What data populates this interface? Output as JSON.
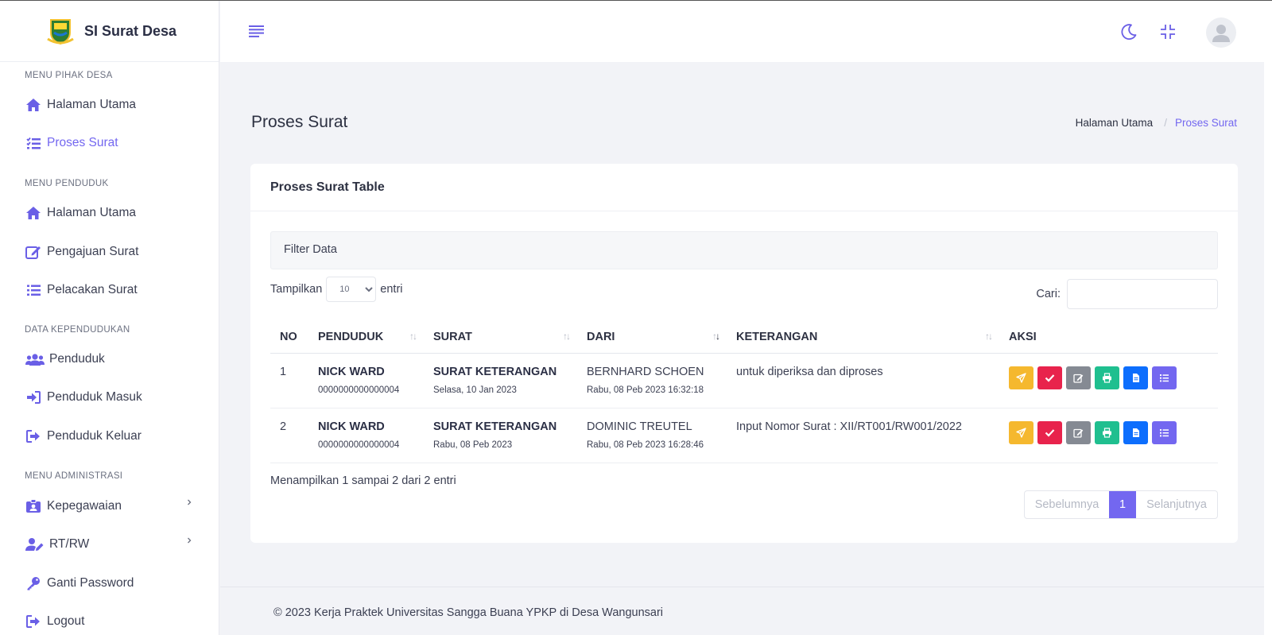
{
  "app": {
    "title": "SI Surat Desa"
  },
  "sidebar": {
    "sections": [
      {
        "label": "MENU PIHAK DESA",
        "items": [
          {
            "label": "Halaman Utama",
            "icon": "home-icon"
          },
          {
            "label": "Proses Surat",
            "icon": "list-check-icon",
            "active": true
          }
        ]
      },
      {
        "label": "MENU PENDUDUK",
        "items": [
          {
            "label": "Halaman Utama",
            "icon": "home-icon"
          },
          {
            "label": "Pengajuan Surat",
            "icon": "edit-icon"
          },
          {
            "label": "Pelacakan Surat",
            "icon": "list-icon"
          }
        ]
      },
      {
        "label": "DATA KEPENDUDUKAN",
        "items": [
          {
            "label": "Penduduk",
            "icon": "users-icon"
          },
          {
            "label": "Penduduk Masuk",
            "icon": "sign-in-icon"
          },
          {
            "label": "Penduduk Keluar",
            "icon": "sign-out-icon"
          }
        ]
      },
      {
        "label": "MENU ADMINISTRASI",
        "items": [
          {
            "label": "Kepegawaian",
            "icon": "id-badge-icon",
            "submenu": true
          },
          {
            "label": "RT/RW",
            "icon": "user-edit-icon",
            "submenu": true
          },
          {
            "label": "Ganti Password",
            "icon": "key-icon"
          },
          {
            "label": "Logout",
            "icon": "logout-icon"
          }
        ]
      }
    ]
  },
  "header": {
    "page_title": "Proses Surat",
    "breadcrumb": [
      "Halaman Utama",
      "Proses Surat"
    ]
  },
  "card": {
    "title": "Proses Surat Table",
    "filter_label": "Filter Data",
    "length_prefix": "Tampilkan",
    "length_value": "10",
    "length_suffix": "entri",
    "search_label": "Cari:",
    "columns": [
      "NO",
      "PENDUDUK",
      "SURAT",
      "DARI",
      "KETERANGAN",
      "AKSI"
    ],
    "rows": [
      {
        "no": "1",
        "penduduk": "NICK WARD",
        "nik": "0000000000000004",
        "surat": "SURAT KETERANGAN",
        "surat_date": "Selasa, 10 Jan 2023",
        "dari": "BERNHARD SCHOEN",
        "dari_date": "Rabu, 08 Peb 2023 16:32:18",
        "keterangan": "untuk diperiksa dan diproses"
      },
      {
        "no": "2",
        "penduduk": "NICK WARD",
        "nik": "0000000000000004",
        "surat": "SURAT KETERANGAN",
        "surat_date": "Rabu, 08 Peb 2023",
        "dari": "DOMINIC TREUTEL",
        "dari_date": "Rabu, 08 Peb 2023 16:28:46",
        "keterangan": "Input Nomor Surat : XII/RT001/RW001/2022"
      }
    ],
    "info": "Menampilkan 1 sampai 2 dari 2 entri",
    "pager": {
      "prev": "Sebelumnya",
      "current": "1",
      "next": "Selanjutnya"
    }
  },
  "footer": {
    "text": "© 2023 Kerja Praktek Universitas Sangga Buana YPKP di Desa Wangunsari"
  },
  "colors": {
    "accent": "#7367f0",
    "warning": "#f5b82e",
    "danger": "#e8234c",
    "secondary": "#858a93",
    "success": "#1fbf8f",
    "primary": "#0d6efd"
  }
}
